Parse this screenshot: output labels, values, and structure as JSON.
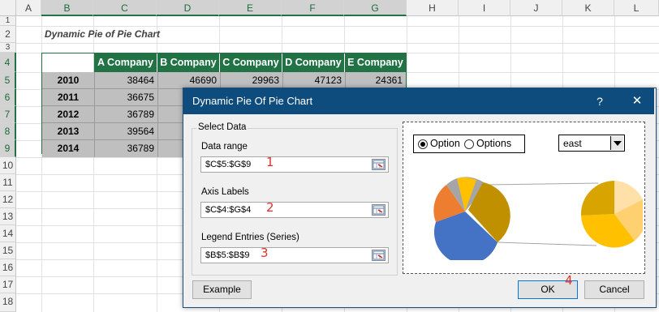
{
  "sheet": {
    "columns": [
      "A",
      "B",
      "C",
      "D",
      "E",
      "F",
      "G",
      "H",
      "I",
      "J",
      "K",
      "L"
    ],
    "rows": [
      "1",
      "2",
      "3",
      "4",
      "5",
      "6",
      "7",
      "8",
      "9",
      "10",
      "11",
      "12",
      "13",
      "14",
      "15",
      "16",
      "17",
      "18"
    ],
    "title": "Dynamic Pie of Pie Chart",
    "table": {
      "headers": [
        "A Company",
        "B Company",
        "C Company",
        "D Company",
        "E Company"
      ],
      "rows": [
        {
          "year": "2010",
          "values": [
            "38464",
            "46690",
            "29963",
            "47123",
            "24361"
          ]
        },
        {
          "year": "2011",
          "values": [
            "36675",
            "",
            "",
            "",
            ""
          ]
        },
        {
          "year": "2012",
          "values": [
            "36789",
            "",
            "",
            "",
            ""
          ]
        },
        {
          "year": "2013",
          "values": [
            "39564",
            "",
            "",
            "",
            ""
          ]
        },
        {
          "year": "2014",
          "values": [
            "36789",
            "",
            "",
            "",
            ""
          ]
        }
      ]
    }
  },
  "dialog": {
    "title": "Dynamic Pie Of Pie Chart",
    "help_label": "?",
    "close_label": "✕",
    "group_label": "Select Data",
    "data_range": {
      "label": "Data range",
      "value": "$C$5:$G$9",
      "badge": "1"
    },
    "axis_labels": {
      "label": "Axis Labels",
      "value": "$C$4:$G$4",
      "badge": "2"
    },
    "legend_entries": {
      "label": "Legend Entries (Series)",
      "value": "$B$5:$B$9",
      "badge": "3"
    },
    "option1_label": "Option",
    "option2_label": "Options",
    "dropdown_value": "east",
    "example_label": "Example",
    "ok_label": "OK",
    "ok_badge": "4",
    "cancel_label": "Cancel",
    "colors": {
      "titlebar": "#0e4c7d",
      "header_green": "#217346"
    }
  },
  "preview_chart": {
    "left_pie_slices": [
      "#a5a5a5",
      "#ffc000",
      "#c09000",
      "#4472c4",
      "#ed7d31"
    ],
    "right_pie_slices": [
      "#ffd88a",
      "#ffcc66",
      "#ffc000",
      "#e0a800"
    ]
  }
}
